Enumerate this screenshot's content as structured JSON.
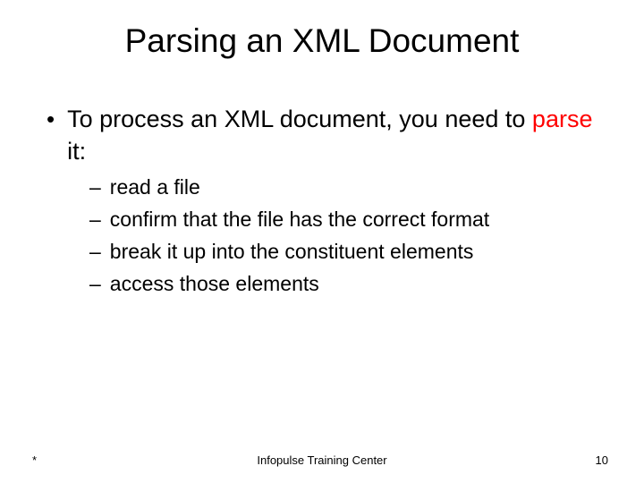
{
  "title": "Parsing an XML Document",
  "main": {
    "prefix": "To process an XML document, you need to ",
    "highlight": "parse",
    "suffix": " it:"
  },
  "subitems": [
    "read a file",
    "confirm that the file has the correct format",
    "break it up into the constituent elements",
    "access those elements"
  ],
  "footer": {
    "left": "*",
    "center": "Infopulse Training Center",
    "right": "10"
  }
}
